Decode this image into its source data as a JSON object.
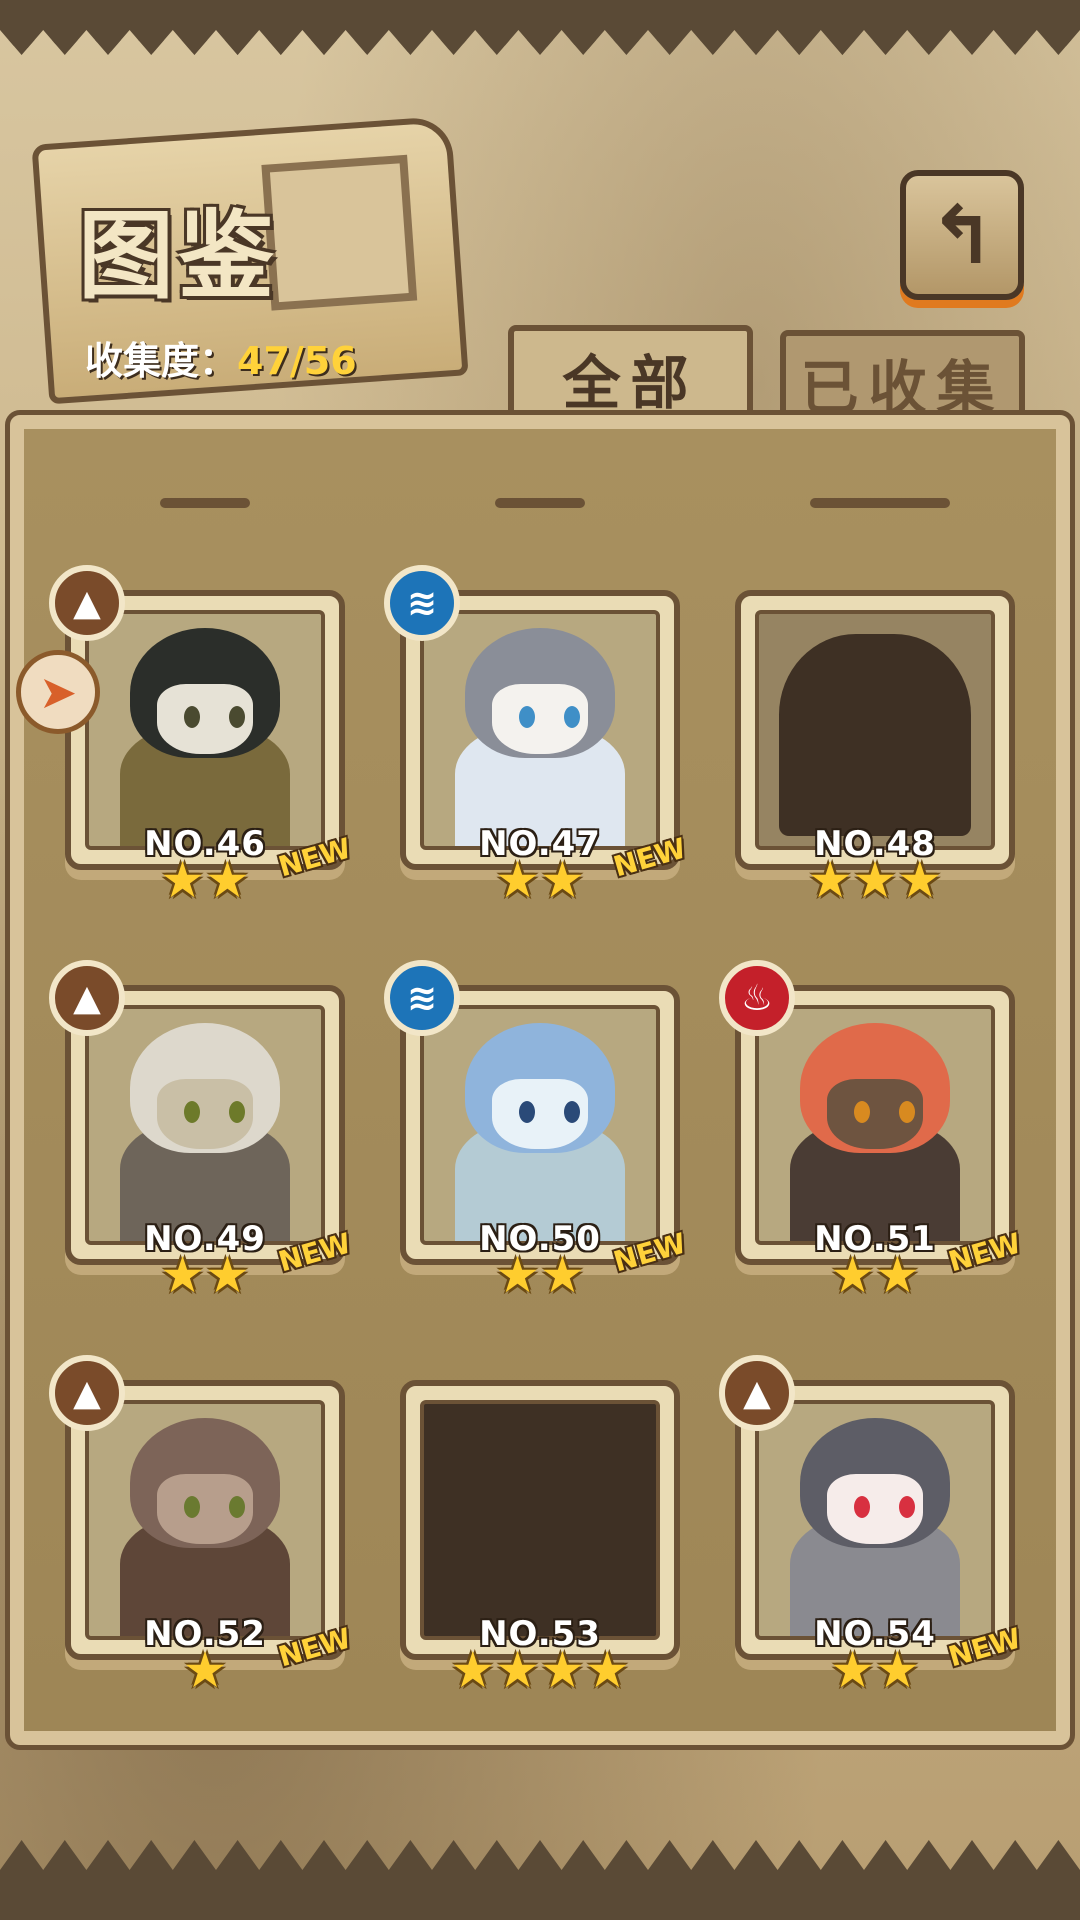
{
  "header": {
    "title": "图鉴",
    "collection_label": "收集度：",
    "collection_value": "47/56"
  },
  "tabs": [
    {
      "label": "全部",
      "active": true
    },
    {
      "label": "已收集",
      "active": false
    }
  ],
  "icons": {
    "back": "return-arrow-icon",
    "side": "sort-arrow-icon"
  },
  "colors": {
    "star": "#ffcd2e",
    "new_tag": "#ffd23a",
    "earth": "#7a4b2a",
    "water": "#1d74b8",
    "fire": "#c4202a"
  },
  "cards": [
    {
      "number": "NO.46",
      "new": "NEW",
      "stars": 2,
      "element": "earth",
      "state": "collected"
    },
    {
      "number": "NO.47",
      "new": "NEW",
      "stars": 2,
      "element": "water",
      "state": "collected"
    },
    {
      "number": "NO.48",
      "new": "",
      "stars": 3,
      "element": "",
      "state": "silhouette"
    },
    {
      "number": "NO.49",
      "new": "NEW",
      "stars": 2,
      "element": "earth",
      "state": "collected"
    },
    {
      "number": "NO.50",
      "new": "NEW",
      "stars": 2,
      "element": "water",
      "state": "collected"
    },
    {
      "number": "NO.51",
      "new": "NEW",
      "stars": 2,
      "element": "fire",
      "state": "collected"
    },
    {
      "number": "NO.52",
      "new": "NEW",
      "stars": 1,
      "element": "earth",
      "state": "collected"
    },
    {
      "number": "NO.53",
      "new": "",
      "stars": 4,
      "element": "",
      "state": "locked"
    },
    {
      "number": "NO.54",
      "new": "NEW",
      "stars": 2,
      "element": "earth",
      "state": "collected"
    }
  ]
}
